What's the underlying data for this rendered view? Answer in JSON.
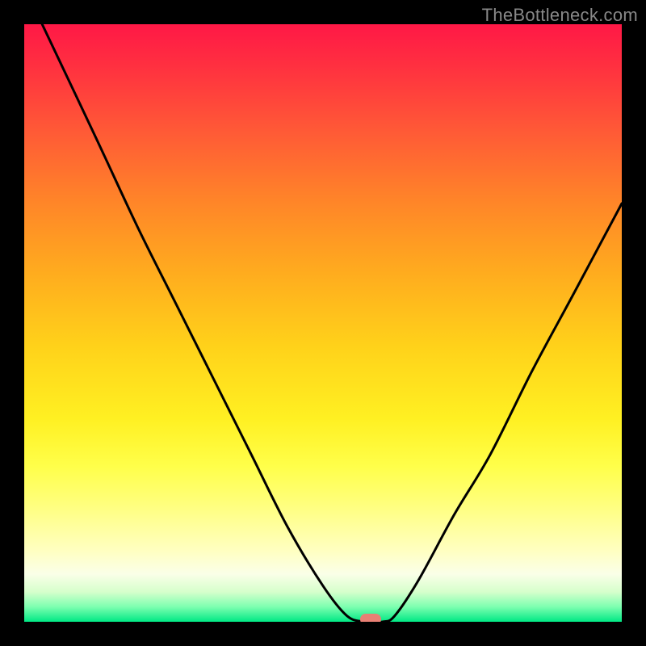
{
  "watermark": "TheBottleneck.com",
  "chart_data": {
    "type": "line",
    "title": "",
    "xlabel": "",
    "ylabel": "",
    "xlim": [
      0,
      100
    ],
    "ylim": [
      0,
      100
    ],
    "grid": false,
    "legend": false,
    "curve_points": [
      {
        "x": 3,
        "y": 100
      },
      {
        "x": 12,
        "y": 81
      },
      {
        "x": 19,
        "y": 66
      },
      {
        "x": 25,
        "y": 54
      },
      {
        "x": 32,
        "y": 40
      },
      {
        "x": 38,
        "y": 28
      },
      {
        "x": 44,
        "y": 16
      },
      {
        "x": 50,
        "y": 6
      },
      {
        "x": 54,
        "y": 1
      },
      {
        "x": 57,
        "y": 0
      },
      {
        "x": 60,
        "y": 0
      },
      {
        "x": 62,
        "y": 1
      },
      {
        "x": 66,
        "y": 7
      },
      {
        "x": 72,
        "y": 18
      },
      {
        "x": 78,
        "y": 28
      },
      {
        "x": 85,
        "y": 42
      },
      {
        "x": 92,
        "y": 55
      },
      {
        "x": 100,
        "y": 70
      }
    ],
    "marker": {
      "x": 58,
      "y": 0
    }
  },
  "colors": {
    "curve": "#000000",
    "marker": "#e98074",
    "background_frame": "#000000"
  }
}
